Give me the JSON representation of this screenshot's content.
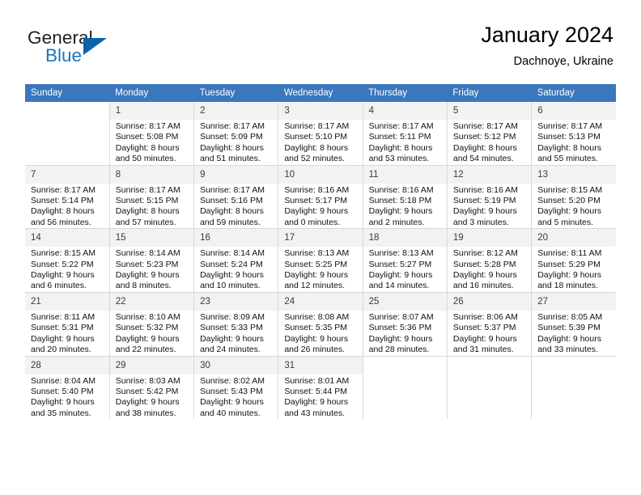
{
  "brand": {
    "name_part1": "General",
    "name_part2": "Blue",
    "triangle_color": "#0b63ab",
    "blue_color": "#1b75bb"
  },
  "header": {
    "title": "January 2024",
    "subtitle": "Dachnoye, Ukraine"
  },
  "theme": {
    "header_row_bg": "#3a77bd",
    "header_row_text": "#ffffff",
    "daynum_bg": "#f2f2f2",
    "grid_line": "#d8d8d8"
  },
  "weekday_headers": [
    "Sunday",
    "Monday",
    "Tuesday",
    "Wednesday",
    "Thursday",
    "Friday",
    "Saturday"
  ],
  "weeks": [
    [
      {
        "day": "",
        "lines": []
      },
      {
        "day": "1",
        "lines": [
          "Sunrise: 8:17 AM",
          "Sunset: 5:08 PM",
          "Daylight: 8 hours",
          "and 50 minutes."
        ]
      },
      {
        "day": "2",
        "lines": [
          "Sunrise: 8:17 AM",
          "Sunset: 5:09 PM",
          "Daylight: 8 hours",
          "and 51 minutes."
        ]
      },
      {
        "day": "3",
        "lines": [
          "Sunrise: 8:17 AM",
          "Sunset: 5:10 PM",
          "Daylight: 8 hours",
          "and 52 minutes."
        ]
      },
      {
        "day": "4",
        "lines": [
          "Sunrise: 8:17 AM",
          "Sunset: 5:11 PM",
          "Daylight: 8 hours",
          "and 53 minutes."
        ]
      },
      {
        "day": "5",
        "lines": [
          "Sunrise: 8:17 AM",
          "Sunset: 5:12 PM",
          "Daylight: 8 hours",
          "and 54 minutes."
        ]
      },
      {
        "day": "6",
        "lines": [
          "Sunrise: 8:17 AM",
          "Sunset: 5:13 PM",
          "Daylight: 8 hours",
          "and 55 minutes."
        ]
      }
    ],
    [
      {
        "day": "7",
        "lines": [
          "Sunrise: 8:17 AM",
          "Sunset: 5:14 PM",
          "Daylight: 8 hours",
          "and 56 minutes."
        ]
      },
      {
        "day": "8",
        "lines": [
          "Sunrise: 8:17 AM",
          "Sunset: 5:15 PM",
          "Daylight: 8 hours",
          "and 57 minutes."
        ]
      },
      {
        "day": "9",
        "lines": [
          "Sunrise: 8:17 AM",
          "Sunset: 5:16 PM",
          "Daylight: 8 hours",
          "and 59 minutes."
        ]
      },
      {
        "day": "10",
        "lines": [
          "Sunrise: 8:16 AM",
          "Sunset: 5:17 PM",
          "Daylight: 9 hours",
          "and 0 minutes."
        ]
      },
      {
        "day": "11",
        "lines": [
          "Sunrise: 8:16 AM",
          "Sunset: 5:18 PM",
          "Daylight: 9 hours",
          "and 2 minutes."
        ]
      },
      {
        "day": "12",
        "lines": [
          "Sunrise: 8:16 AM",
          "Sunset: 5:19 PM",
          "Daylight: 9 hours",
          "and 3 minutes."
        ]
      },
      {
        "day": "13",
        "lines": [
          "Sunrise: 8:15 AM",
          "Sunset: 5:20 PM",
          "Daylight: 9 hours",
          "and 5 minutes."
        ]
      }
    ],
    [
      {
        "day": "14",
        "lines": [
          "Sunrise: 8:15 AM",
          "Sunset: 5:22 PM",
          "Daylight: 9 hours",
          "and 6 minutes."
        ]
      },
      {
        "day": "15",
        "lines": [
          "Sunrise: 8:14 AM",
          "Sunset: 5:23 PM",
          "Daylight: 9 hours",
          "and 8 minutes."
        ]
      },
      {
        "day": "16",
        "lines": [
          "Sunrise: 8:14 AM",
          "Sunset: 5:24 PM",
          "Daylight: 9 hours",
          "and 10 minutes."
        ]
      },
      {
        "day": "17",
        "lines": [
          "Sunrise: 8:13 AM",
          "Sunset: 5:25 PM",
          "Daylight: 9 hours",
          "and 12 minutes."
        ]
      },
      {
        "day": "18",
        "lines": [
          "Sunrise: 8:13 AM",
          "Sunset: 5:27 PM",
          "Daylight: 9 hours",
          "and 14 minutes."
        ]
      },
      {
        "day": "19",
        "lines": [
          "Sunrise: 8:12 AM",
          "Sunset: 5:28 PM",
          "Daylight: 9 hours",
          "and 16 minutes."
        ]
      },
      {
        "day": "20",
        "lines": [
          "Sunrise: 8:11 AM",
          "Sunset: 5:29 PM",
          "Daylight: 9 hours",
          "and 18 minutes."
        ]
      }
    ],
    [
      {
        "day": "21",
        "lines": [
          "Sunrise: 8:11 AM",
          "Sunset: 5:31 PM",
          "Daylight: 9 hours",
          "and 20 minutes."
        ]
      },
      {
        "day": "22",
        "lines": [
          "Sunrise: 8:10 AM",
          "Sunset: 5:32 PM",
          "Daylight: 9 hours",
          "and 22 minutes."
        ]
      },
      {
        "day": "23",
        "lines": [
          "Sunrise: 8:09 AM",
          "Sunset: 5:33 PM",
          "Daylight: 9 hours",
          "and 24 minutes."
        ]
      },
      {
        "day": "24",
        "lines": [
          "Sunrise: 8:08 AM",
          "Sunset: 5:35 PM",
          "Daylight: 9 hours",
          "and 26 minutes."
        ]
      },
      {
        "day": "25",
        "lines": [
          "Sunrise: 8:07 AM",
          "Sunset: 5:36 PM",
          "Daylight: 9 hours",
          "and 28 minutes."
        ]
      },
      {
        "day": "26",
        "lines": [
          "Sunrise: 8:06 AM",
          "Sunset: 5:37 PM",
          "Daylight: 9 hours",
          "and 31 minutes."
        ]
      },
      {
        "day": "27",
        "lines": [
          "Sunrise: 8:05 AM",
          "Sunset: 5:39 PM",
          "Daylight: 9 hours",
          "and 33 minutes."
        ]
      }
    ],
    [
      {
        "day": "28",
        "lines": [
          "Sunrise: 8:04 AM",
          "Sunset: 5:40 PM",
          "Daylight: 9 hours",
          "and 35 minutes."
        ]
      },
      {
        "day": "29",
        "lines": [
          "Sunrise: 8:03 AM",
          "Sunset: 5:42 PM",
          "Daylight: 9 hours",
          "and 38 minutes."
        ]
      },
      {
        "day": "30",
        "lines": [
          "Sunrise: 8:02 AM",
          "Sunset: 5:43 PM",
          "Daylight: 9 hours",
          "and 40 minutes."
        ]
      },
      {
        "day": "31",
        "lines": [
          "Sunrise: 8:01 AM",
          "Sunset: 5:44 PM",
          "Daylight: 9 hours",
          "and 43 minutes."
        ]
      },
      {
        "day": "",
        "lines": []
      },
      {
        "day": "",
        "lines": []
      },
      {
        "day": "",
        "lines": []
      }
    ]
  ]
}
